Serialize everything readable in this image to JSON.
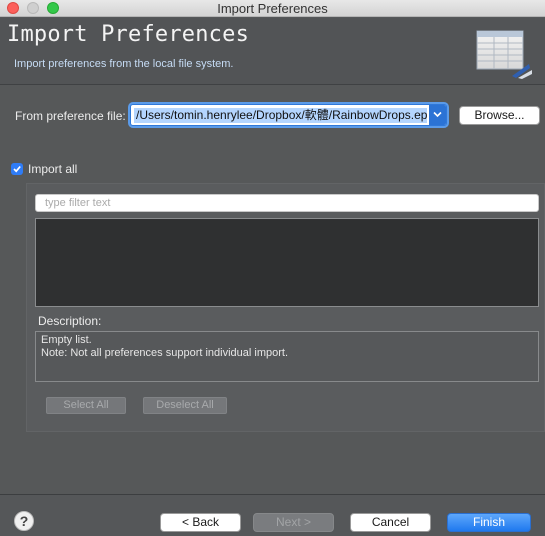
{
  "window": {
    "title": "Import Preferences"
  },
  "banner": {
    "title": "Import Preferences",
    "description": "Import preferences from the local file system.",
    "icon": "preferences-table-icon"
  },
  "form": {
    "from_label": "From preference file:",
    "path_value": "/Users/tomin.henrylee/Dropbox/軟體/RainbowDrops.epf",
    "browse_label": "Browse...",
    "import_all_label": "Import all",
    "import_all_checked": true
  },
  "filter": {
    "placeholder": "type filter text"
  },
  "description": {
    "label": "Description:",
    "lines": [
      "Empty list.",
      "Note: Not all preferences support individual import."
    ]
  },
  "selection": {
    "select_all_label": "Select All",
    "deselect_all_label": "Deselect All"
  },
  "footer": {
    "help_glyph": "?",
    "back_label": "< Back",
    "next_label": "Next >",
    "cancel_label": "Cancel",
    "finish_label": "Finish"
  },
  "colors": {
    "accent": "#2f7cf6",
    "finish_button": "#1f79ef",
    "background": "#555759"
  }
}
